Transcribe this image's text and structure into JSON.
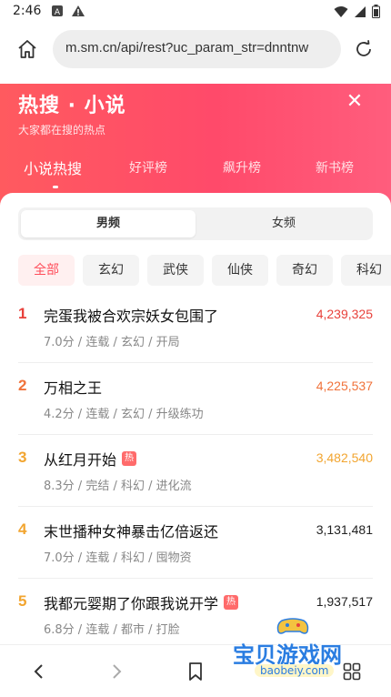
{
  "status_bar": {
    "time": "2:46"
  },
  "browser": {
    "url": "m.sm.cn/api/rest?uc_param_str=dnntnw"
  },
  "header": {
    "title": "热搜 · 小说",
    "subtitle": "大家都在搜的热点",
    "tabs": [
      "小说热搜",
      "好评榜",
      "飙升榜",
      "新书榜"
    ],
    "active_tab": 0
  },
  "gender": {
    "options": [
      "男频",
      "女频"
    ],
    "selected": "男频"
  },
  "filters": [
    "全部",
    "玄幻",
    "武侠",
    "仙侠",
    "奇幻",
    "科幻"
  ],
  "selected_filter": "全部",
  "books": [
    {
      "rank": "1",
      "title": "完蛋我被合欢宗妖女包围了",
      "hot": false,
      "meta": "7.0分 / 连载 / 玄幻 / 开局",
      "score": "4,239,325"
    },
    {
      "rank": "2",
      "title": "万相之王",
      "hot": false,
      "meta": "4.2分 / 连载 / 玄幻 / 升级练功",
      "score": "4,225,537"
    },
    {
      "rank": "3",
      "title": "从红月开始",
      "hot": true,
      "hot_label": "热",
      "meta": "8.3分 / 完结 / 科幻 / 进化流",
      "score": "3,482,540"
    },
    {
      "rank": "4",
      "title": "末世播种女神暴击亿倍返还",
      "hot": false,
      "meta": "7.0分 / 连载 / 科幻 / 囤物资",
      "score": "3,131,481"
    },
    {
      "rank": "5",
      "title": "我都元婴期了你跟我说开学",
      "hot": true,
      "hot_label": "热",
      "meta": "6.8分 / 连载 / 都市 / 打脸",
      "score": "1,937,517"
    }
  ],
  "colors": {
    "accent": "#ff4d5a",
    "rank_1": "#e8413b",
    "rank_2": "#f0723a",
    "rank_3": "#f2a530",
    "rank_other": "#f2a530",
    "score_top": "#e8413b",
    "score_normal": "#222222"
  },
  "watermark": {
    "text": "宝贝游戏网",
    "url": "baobeiy.com"
  }
}
